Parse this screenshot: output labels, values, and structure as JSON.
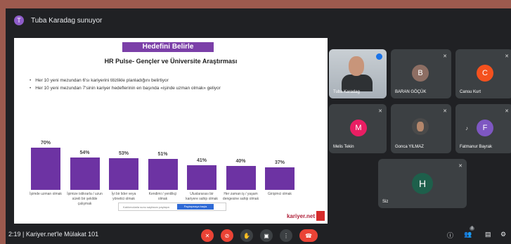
{
  "presenter": {
    "initial": "T",
    "text": "Tuba Karadag sunuyor"
  },
  "slide": {
    "title": "Hedefini Belirle",
    "subtitle": "HR Pulse- Gençler ve Üniversite Araştırması",
    "bullets": [
      "Her 10 yeni mezundan 6'sı kariyerini titizlikle planladığını belirtiyor",
      "Her 10 yeni mezundan 7'sinin kariyer hedeflerinin en başında «işinde uzman olmak» geliyor"
    ],
    "share_text": "Katılımcılarla sunu sayfasını paylaşın",
    "share_button": "Paylaşmaya başla",
    "brand": "kariyer.net"
  },
  "chart_data": {
    "type": "bar",
    "categories": [
      "İşimde uzman olmak",
      "İşimize istikrarla / uzun süreli bir şekilde çalışmak",
      "İyi bir lider veya yönetici olmak",
      "Kendimi / yenilikçi olmak",
      "Uluslararası bir kariyere sahip olmak",
      "Her zaman iş / yaşam dengesine sahip olmak",
      "Girişimci olmak"
    ],
    "values": [
      70,
      54,
      53,
      51,
      41,
      40,
      37
    ],
    "labels": [
      "70%",
      "54%",
      "53%",
      "51%",
      "41%",
      "40%",
      "37%"
    ],
    "color": "#6d33a3",
    "ylim": [
      0,
      70
    ]
  },
  "participants": [
    {
      "name": "Tuba Karadag",
      "type": "video"
    },
    {
      "name": "BARAN GÖÇÜK",
      "initial": "B",
      "color": "#8d6e63"
    },
    {
      "name": "Cansu Kurt",
      "initial": "C",
      "color": "#f4511e"
    },
    {
      "name": "Melis Tekin",
      "initial": "M",
      "color": "#e91e63"
    },
    {
      "name": "Gonca YILMAZ",
      "initial": "",
      "color": "#4a4a4a"
    },
    {
      "name": "Fatmanur Bayrak",
      "initial": "F",
      "color": "#7e57c2"
    },
    {
      "name": "Siz",
      "initial": "H",
      "color": "#1e5f4b"
    }
  ],
  "bottombar": {
    "meeting_info": "2:19  |  Kariyer.net'le Mülakat 101",
    "participant_count": "8"
  }
}
